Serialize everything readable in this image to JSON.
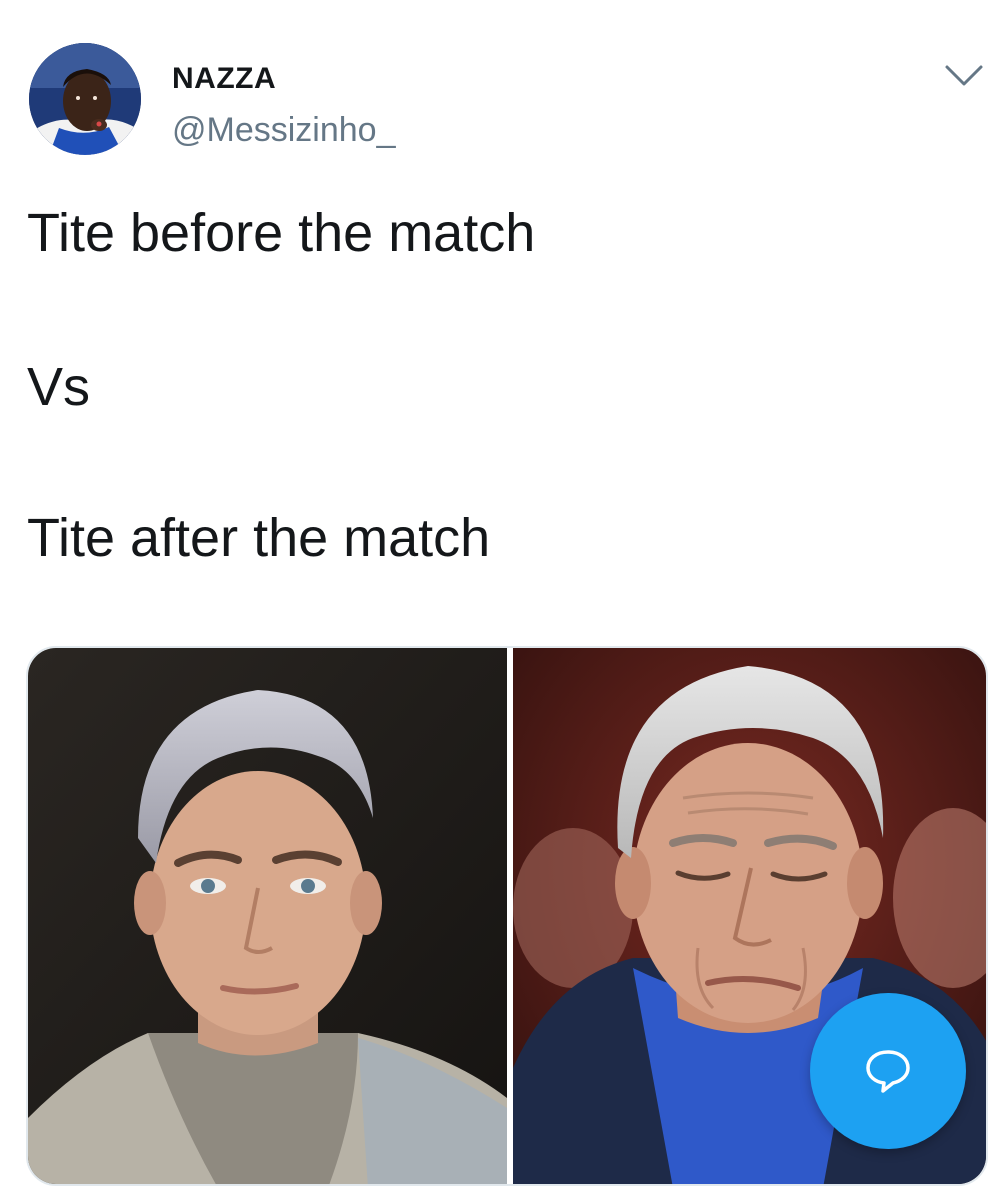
{
  "author": {
    "display_name": "NAZZA",
    "handle": "@Messizinho_",
    "avatar_icon": "profile-photo"
  },
  "tweet": {
    "lines": [
      "Tite before the match",
      "Vs",
      "Tite after the match"
    ]
  },
  "media": {
    "photos": [
      {
        "subject": "young man with dyed silver hair, grey hoodie and denim jacket"
      },
      {
        "subject": "older man with grey hair, navy suit and blue shirt"
      }
    ]
  },
  "icons": {
    "menu": "chevron-down-icon",
    "compose": "speech-bubble-icon"
  },
  "colors": {
    "accent": "#1da1f2",
    "text": "#14171a",
    "secondary_text": "#657786",
    "border": "#e1e8ed"
  }
}
